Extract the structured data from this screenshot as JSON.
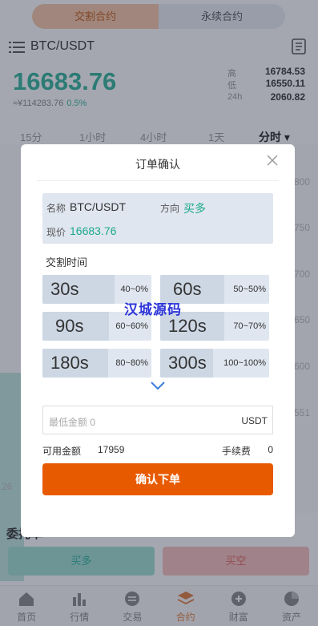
{
  "top_tabs": [
    "交割合约",
    "永续合约"
  ],
  "pair": "BTC/USDT",
  "price": "16683.76",
  "sub_price": "≈¥114283.76",
  "change_pct": "0.5%",
  "stats": [
    {
      "label": "高",
      "value": "16784.53"
    },
    {
      "label": "低",
      "value": "16550.11"
    },
    {
      "label": "24h",
      "value": "2060.82"
    }
  ],
  "intervals": [
    "15分",
    "1小时",
    "4小时",
    "1天",
    "分时"
  ],
  "chart_ticks": [
    "800",
    "750",
    "700",
    "650",
    "600",
    "551"
  ],
  "chart_left_label": "26",
  "entrust_title": "委托单",
  "buy_label": "买多",
  "sell_label": "买空",
  "tabbar": [
    "首页",
    "行情",
    "交易",
    "合约",
    "财富",
    "资产"
  ],
  "modal": {
    "title": "订单确认",
    "name_label": "名称",
    "name_value": "BTC/USDT",
    "direction_label": "方向",
    "direction_value": "买多",
    "price_label": "现价",
    "price_value": "16683.76",
    "section_label": "交割时间",
    "periods": [
      {
        "time": "30s",
        "rate": "40~0%"
      },
      {
        "time": "60s",
        "rate": "50~50%"
      },
      {
        "time": "90s",
        "rate": "60~60%"
      },
      {
        "time": "120s",
        "rate": "70~70%"
      },
      {
        "time": "180s",
        "rate": "80~80%"
      },
      {
        "time": "300s",
        "rate": "100~100%"
      }
    ],
    "amount_placeholder": "最低金额 0",
    "amount_unit": "USDT",
    "available_label": "可用金额",
    "available_value": "17959",
    "fee_label": "手续费",
    "fee_value": "0",
    "confirm_label": "确认下单"
  },
  "watermark": "汉城源码",
  "colors": {
    "accent": "#e85a00",
    "green": "#1ca88c",
    "tab_active": "#f6c7a6"
  }
}
